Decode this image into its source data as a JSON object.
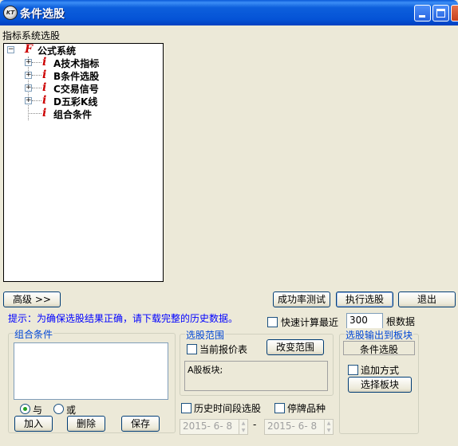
{
  "window": {
    "title": "条件选股",
    "icon_text": "KT"
  },
  "tree": {
    "header": "指标系统选股",
    "root": {
      "icon": "F",
      "label": "公式系统"
    },
    "items": [
      {
        "icon": "i",
        "label": "A技术指标",
        "expand": "+"
      },
      {
        "icon": "i",
        "label": "B条件选股",
        "expand": "+"
      },
      {
        "icon": "i",
        "label": "C交易信号",
        "expand": "+"
      },
      {
        "icon": "i",
        "label": "D五彩K线",
        "expand": "+"
      },
      {
        "icon": "i",
        "label": "组合条件",
        "expand": ""
      }
    ]
  },
  "buttons": {
    "advanced": "高级 >>",
    "success_test": "成功率测试",
    "execute": "执行选股",
    "exit": "退出",
    "add": "加入",
    "delete": "删除",
    "save": "保存",
    "change_range": "改变范围",
    "select_block": "选择板块"
  },
  "hint": "提示：为确保选股结果正确，请下载完整的历史数据。",
  "fast_calc": {
    "label": "快速计算最近",
    "value": "300",
    "suffix": "根数据"
  },
  "combo_group": {
    "title": "组合条件",
    "radio_and": "与",
    "radio_or": "或"
  },
  "range_group": {
    "title": "选股范围",
    "current_quote": "当前报价表",
    "range_text": "A股板块;"
  },
  "output_group": {
    "title": "选股输出到板块",
    "block_name": "条件选股",
    "append_label": "追加方式"
  },
  "history": {
    "label": "历史时间段选股",
    "suspended_label": "停牌品种",
    "date_from": "2015- 6- 8",
    "date_sep": "-",
    "date_to": "2015- 6- 8"
  }
}
